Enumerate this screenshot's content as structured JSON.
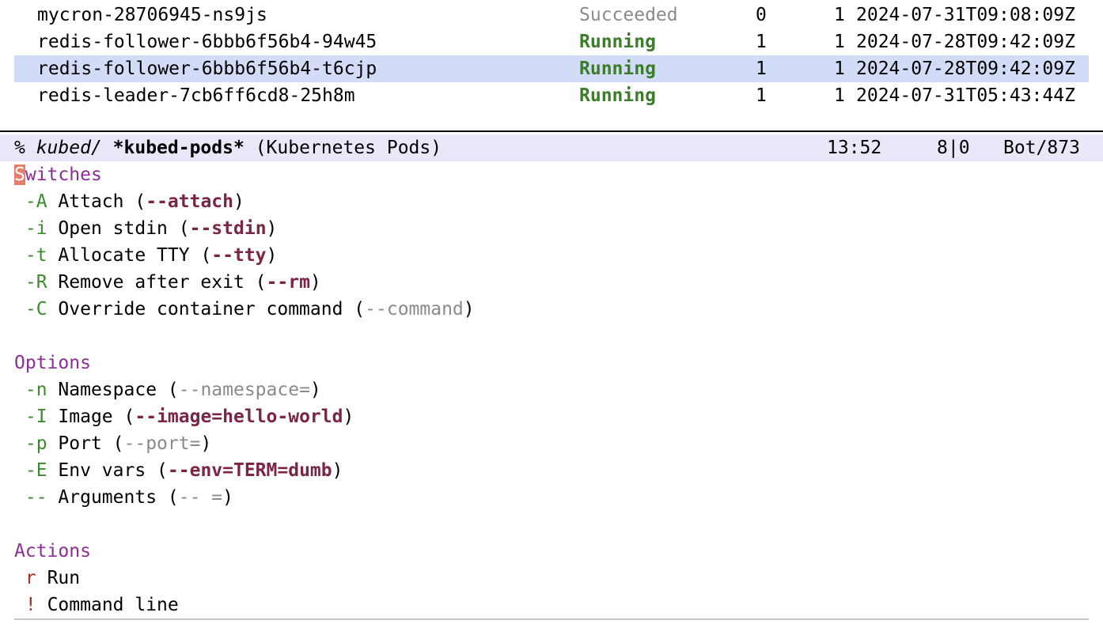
{
  "pods": [
    {
      "name": "mycron-28706945-ns9js",
      "status": "Succeeded",
      "ready": "0",
      "restarts": "1",
      "started": "2024-07-31T09:08:09Z"
    },
    {
      "name": "redis-follower-6bbb6f56b4-94w45",
      "status": "Running",
      "ready": "1",
      "restarts": "1",
      "started": "2024-07-28T09:42:09Z"
    },
    {
      "name": "redis-follower-6bbb6f56b4-t6cjp",
      "status": "Running",
      "ready": "1",
      "restarts": "1",
      "started": "2024-07-28T09:42:09Z"
    },
    {
      "name": "redis-leader-7cb6ff6cd8-25h8m",
      "status": "Running",
      "ready": "1",
      "restarts": "1",
      "started": "2024-07-31T05:43:44Z"
    }
  ],
  "modeline": {
    "prefix": "% ",
    "dir": "kubed/",
    "buffer": "*kubed-pods*",
    "mode": "(Kubernetes Pods)",
    "time": "13:52",
    "position": "8|0",
    "scroll": "Bot/873"
  },
  "switches": {
    "heading_first": "S",
    "heading_rest": "witches",
    "items": [
      {
        "key": "-A",
        "label": "Attach",
        "flag": "--attach",
        "active": true
      },
      {
        "key": "-i",
        "label": "Open stdin",
        "flag": "--stdin",
        "active": true
      },
      {
        "key": "-t",
        "label": "Allocate TTY",
        "flag": "--tty",
        "active": true
      },
      {
        "key": "-R",
        "label": "Remove after exit",
        "flag": "--rm",
        "active": true
      },
      {
        "key": "-C",
        "label": "Override container command",
        "flag": "--command",
        "active": false
      }
    ]
  },
  "options": {
    "heading": "Options",
    "items": [
      {
        "key": "-n",
        "label": "Namespace",
        "flag": "--namespace=",
        "active": false
      },
      {
        "key": "-I",
        "label": "Image",
        "flag": "--image=hello-world",
        "active": true
      },
      {
        "key": "-p",
        "label": "Port",
        "flag": "--port=",
        "active": false
      },
      {
        "key": "-E",
        "label": "Env vars",
        "flag": "--env=TERM=dumb",
        "active": true
      },
      {
        "key": "--",
        "label": "Arguments",
        "flag": "-- =",
        "active": false
      }
    ]
  },
  "actions": {
    "heading": "Actions",
    "items": [
      {
        "key": "r",
        "label": "Run"
      },
      {
        "key": "!",
        "label": "Command line"
      }
    ]
  },
  "colors": {
    "selection": "#d3dcf7",
    "modeline_bg": "#e8e8f8",
    "heading": "#8c2e95",
    "switch_key": "#3c8a2e",
    "action_key": "#b02a26",
    "active_flag": "#7b2545",
    "inactive_flag": "#8a8a8a",
    "running": "#3c7d2c",
    "cursor": "#e87d6b"
  }
}
